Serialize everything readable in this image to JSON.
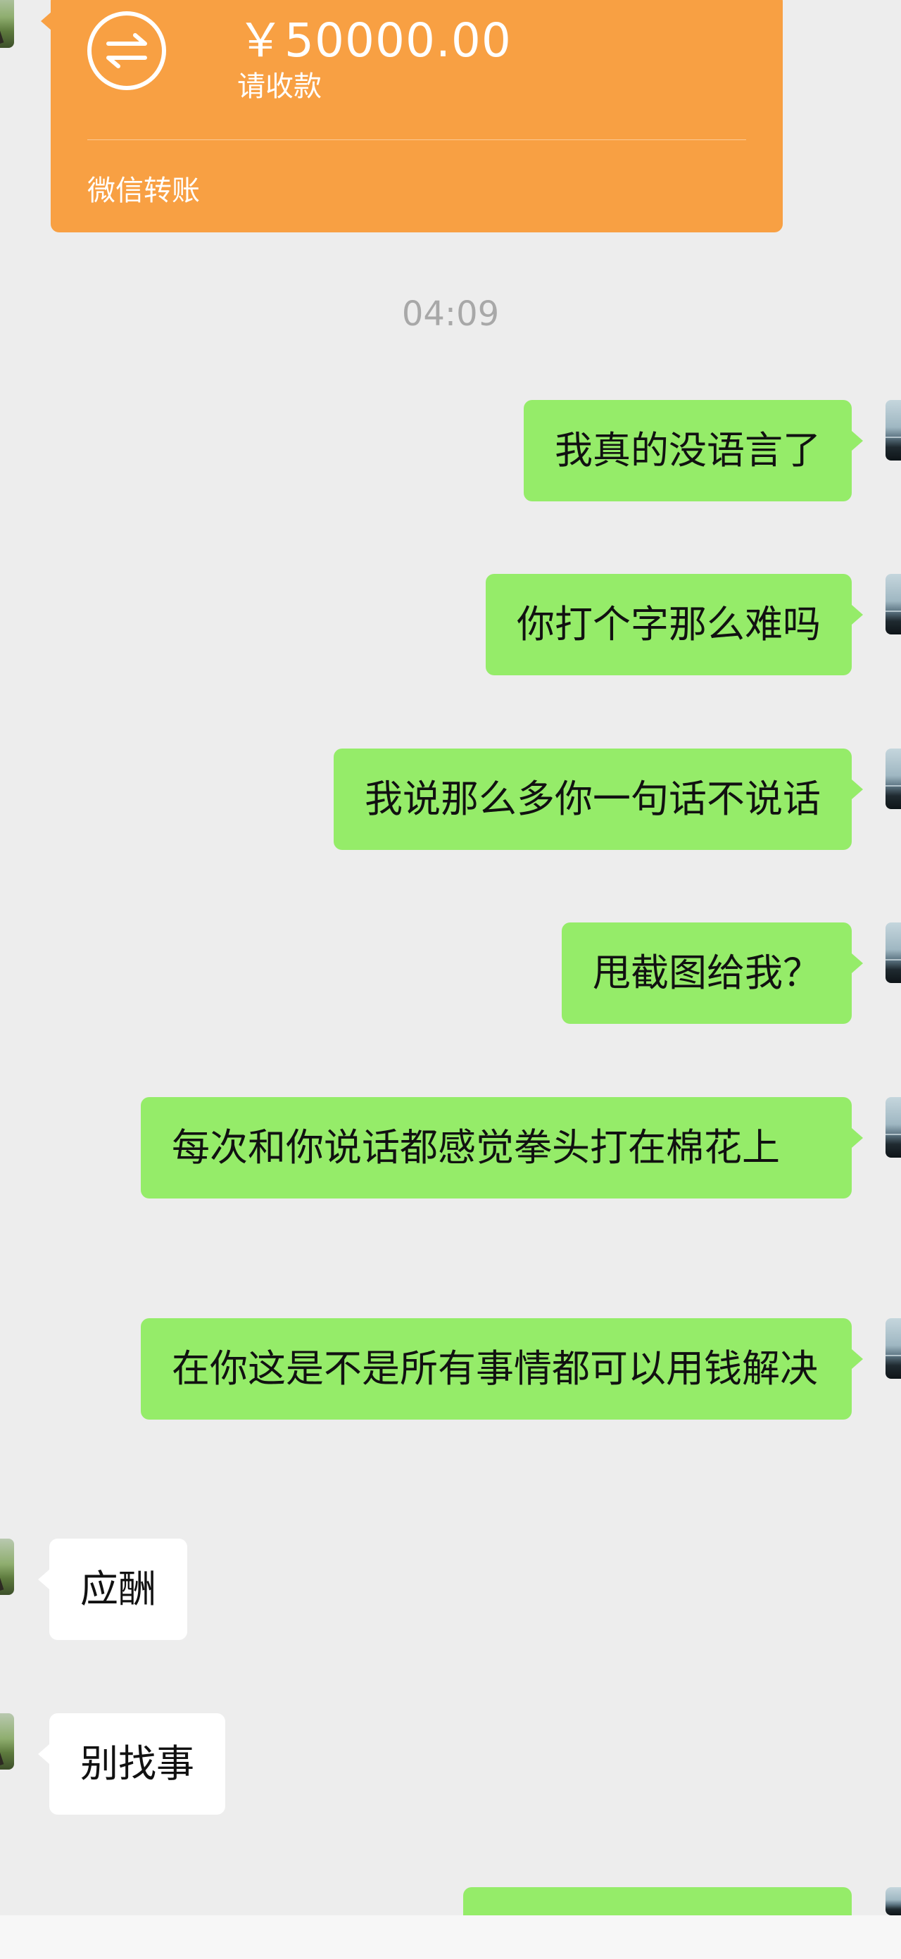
{
  "transfer": {
    "amount": "￥50000.00",
    "subtitle": "请收款",
    "footer": "微信转账",
    "icon": "transfer-arrows-icon",
    "color": "#f8a043"
  },
  "timestamp": "04:09",
  "messages": [
    {
      "side": "out",
      "text": "我真的没语言了"
    },
    {
      "side": "out",
      "text": "你打个字那么难吗"
    },
    {
      "side": "out",
      "text": "我说那么多你一句话不说话"
    },
    {
      "side": "out",
      "text": "甩截图给我？"
    },
    {
      "side": "out",
      "text": "每次和你说话都感觉拳头打在棉花上"
    },
    {
      "side": "out",
      "text": "在你这是不是所有事情都可以用钱解决"
    },
    {
      "side": "in",
      "text": "应酬"
    },
    {
      "side": "in",
      "text": "别找事"
    }
  ],
  "colors": {
    "outgoing_bubble": "#95ec69",
    "incoming_bubble": "#ffffff",
    "background": "#ededed"
  }
}
